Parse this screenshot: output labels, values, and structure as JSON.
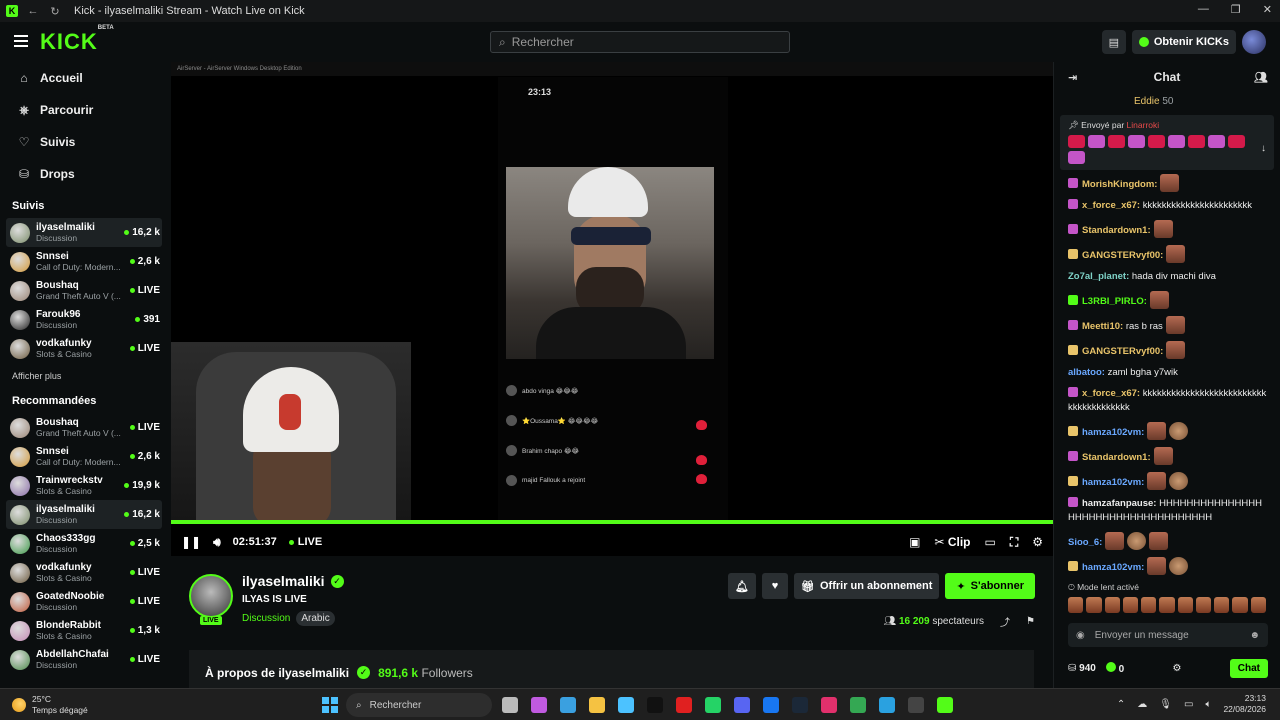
{
  "window": {
    "title": "Kick - ilyaselmaliki Stream - Watch Live on Kick"
  },
  "header": {
    "logo": "KICK",
    "logo_tag": "BETA",
    "search_placeholder": "Rechercher",
    "get_kicks": "Obtenir KICKs"
  },
  "sidebar": {
    "nav": [
      {
        "label": "Accueil",
        "icon": "home-icon"
      },
      {
        "label": "Parcourir",
        "icon": "compass-icon"
      },
      {
        "label": "Suivis",
        "icon": "heart-icon"
      },
      {
        "label": "Drops",
        "icon": "drops-icon"
      }
    ],
    "followed_title": "Suivis",
    "followed": [
      {
        "name": "ilyaselmaliki",
        "category": "Discussion",
        "viewers": "16,2 k",
        "color": "#7c8d6a"
      },
      {
        "name": "Snnsei",
        "category": "Call of Duty: Modern...",
        "viewers": "2,6 k",
        "color": "#d49a3a"
      },
      {
        "name": "Boushaq",
        "category": "Grand Theft Auto V (...",
        "viewers": "LIVE",
        "color": "#9a8474"
      },
      {
        "name": "Farouk96",
        "category": "Discussion",
        "viewers": "391",
        "color": "#222"
      },
      {
        "name": "vodkafunky",
        "category": "Slots & Casino",
        "viewers": "LIVE",
        "color": "#6c5a3e"
      }
    ],
    "show_more": "Afficher plus",
    "recommended_title": "Recommandées",
    "recommended": [
      {
        "name": "Boushaq",
        "category": "Grand Theft Auto V (...",
        "viewers": "LIVE",
        "color": "#9a8474"
      },
      {
        "name": "Snnsei",
        "category": "Call of Duty: Modern...",
        "viewers": "2,6 k",
        "color": "#d49a3a"
      },
      {
        "name": "Trainwreckstv",
        "category": "Slots & Casino",
        "viewers": "19,9 k",
        "color": "#8a6da8"
      },
      {
        "name": "ilyaselmaliki",
        "category": "Discussion",
        "viewers": "16,2 k",
        "color": "#7c8d6a"
      },
      {
        "name": "Chaos333gg",
        "category": "Discussion",
        "viewers": "2,5 k",
        "color": "#3f9a4a"
      },
      {
        "name": "vodkafunky",
        "category": "Slots & Casino",
        "viewers": "LIVE",
        "color": "#6c5a3e"
      },
      {
        "name": "GoatedNoobie",
        "category": "Discussion",
        "viewers": "LIVE",
        "color": "#c05a3a"
      },
      {
        "name": "BlondeRabbit",
        "category": "Slots & Casino",
        "viewers": "1,3 k",
        "color": "#c48ab4"
      },
      {
        "name": "AbdellahChafai",
        "category": "Discussion",
        "viewers": "LIVE",
        "color": "#4c8a4a"
      }
    ]
  },
  "player": {
    "airserver_title": "AirServer - AirServer Windows Desktop Edition",
    "phone_time": "23:13",
    "phone_chat": [
      {
        "user": "abdo vinga",
        "text": "😂😂😂"
      },
      {
        "user": "⭐Oussama⭐",
        "text": "😂😂😂😂"
      },
      {
        "user": "Brahim chapo",
        "text": "😂😂"
      },
      {
        "user": "majid Fallouk",
        "text": "a rejoint"
      }
    ],
    "elapsed": "02:51:37",
    "live_label": "LIVE",
    "clip_label": "Clip",
    "progress_percent": 100
  },
  "stream": {
    "streamer": "ilyaselmaliki",
    "live_badge": "LIVE",
    "title": "ILYAS IS LIVE",
    "category": "Discussion",
    "tag": "Arabic",
    "subscribe_gift": "Offrir un abonnement",
    "subscribe": "S'abonner",
    "viewers": "16 209",
    "viewers_label": "spectateurs",
    "about_label": "À propos de ilyaselmaliki",
    "followers": "891,6 k",
    "followers_label": "Followers"
  },
  "chat": {
    "title": "Chat",
    "pinned_user": "Eddie",
    "pinned_count": "50",
    "gift_header": "Envoyé par",
    "gift_sender": "Linarroki",
    "messages": [
      {
        "user": "MorishKingdom:",
        "color": "#e9c46a",
        "text": "",
        "badge": "#c455c8",
        "emotes": 1
      },
      {
        "user": "x_force_x67:",
        "color": "#e9c46a",
        "text": "kkkkkkkkkkkkkkkkkkkkkkk",
        "badge": "#c455c8",
        "emotes": 0
      },
      {
        "user": "Standardown1:",
        "color": "#e9c46a",
        "text": "",
        "badge": "#c455c8",
        "emotes": 1
      },
      {
        "user": "GANGSTERvyf00:",
        "color": "#e9c46a",
        "text": "",
        "badge": "#e9c46a",
        "emotes": 1
      },
      {
        "user": "Zo7al_planet:",
        "color": "#7fd3c8",
        "text": "hada div machi diva",
        "badge": "",
        "emotes": 0
      },
      {
        "user": "L3RBI_PIRLO:",
        "color": "#53fc18",
        "text": "",
        "badge": "#53fc18",
        "emotes": 1
      },
      {
        "user": "Meetti10:",
        "color": "#e9c46a",
        "text": "ras b ras",
        "badge": "#c455c8",
        "emotes": 1
      },
      {
        "user": "GANGSTERvyf00:",
        "color": "#e9c46a",
        "text": "",
        "badge": "#e9c46a",
        "emotes": 1
      },
      {
        "user": "albatoo:",
        "color": "#6aa8ff",
        "text": "zaml bgha y7wik",
        "badge": "",
        "emotes": 0
      },
      {
        "user": "x_force_x67:",
        "color": "#e9c46a",
        "text": "kkkkkkkkkkkkkkkkkkkkkkkkkkkkkkkkkkkkkkk",
        "badge": "#c455c8",
        "emotes": 0
      },
      {
        "user": "hamza102vm:",
        "color": "#6aa8ff",
        "text": "",
        "badge": "#e9c46a",
        "emotes": 2
      },
      {
        "user": "Standardown1:",
        "color": "#e9c46a",
        "text": "",
        "badge": "#c455c8",
        "emotes": 1
      },
      {
        "user": "hamza102vm:",
        "color": "#6aa8ff",
        "text": "",
        "badge": "#e9c46a",
        "emotes": 2
      },
      {
        "user": "hamzafanpause:",
        "color": "#eee",
        "text": "HHHHHHHHHHHHHHHHHHHHHHHHHHHHHHHHHHHH",
        "badge": "#c455c8",
        "emotes": 0
      },
      {
        "user": "Sioo_6:",
        "color": "#6aa8ff",
        "text": "",
        "badge": "",
        "emotes": 3
      },
      {
        "user": "hamza102vm:",
        "color": "#6aa8ff",
        "text": "",
        "badge": "#e9c46a",
        "emotes": 2
      }
    ],
    "slow_mode": "Mode lent activé",
    "input_placeholder": "Envoyer un message",
    "points": "940",
    "kicks": "0",
    "send_label": "Chat"
  },
  "taskbar": {
    "temp": "25°C",
    "weather": "Temps dégagé",
    "search": "Rechercher",
    "time": "23:13",
    "date": "22/08/2026"
  }
}
